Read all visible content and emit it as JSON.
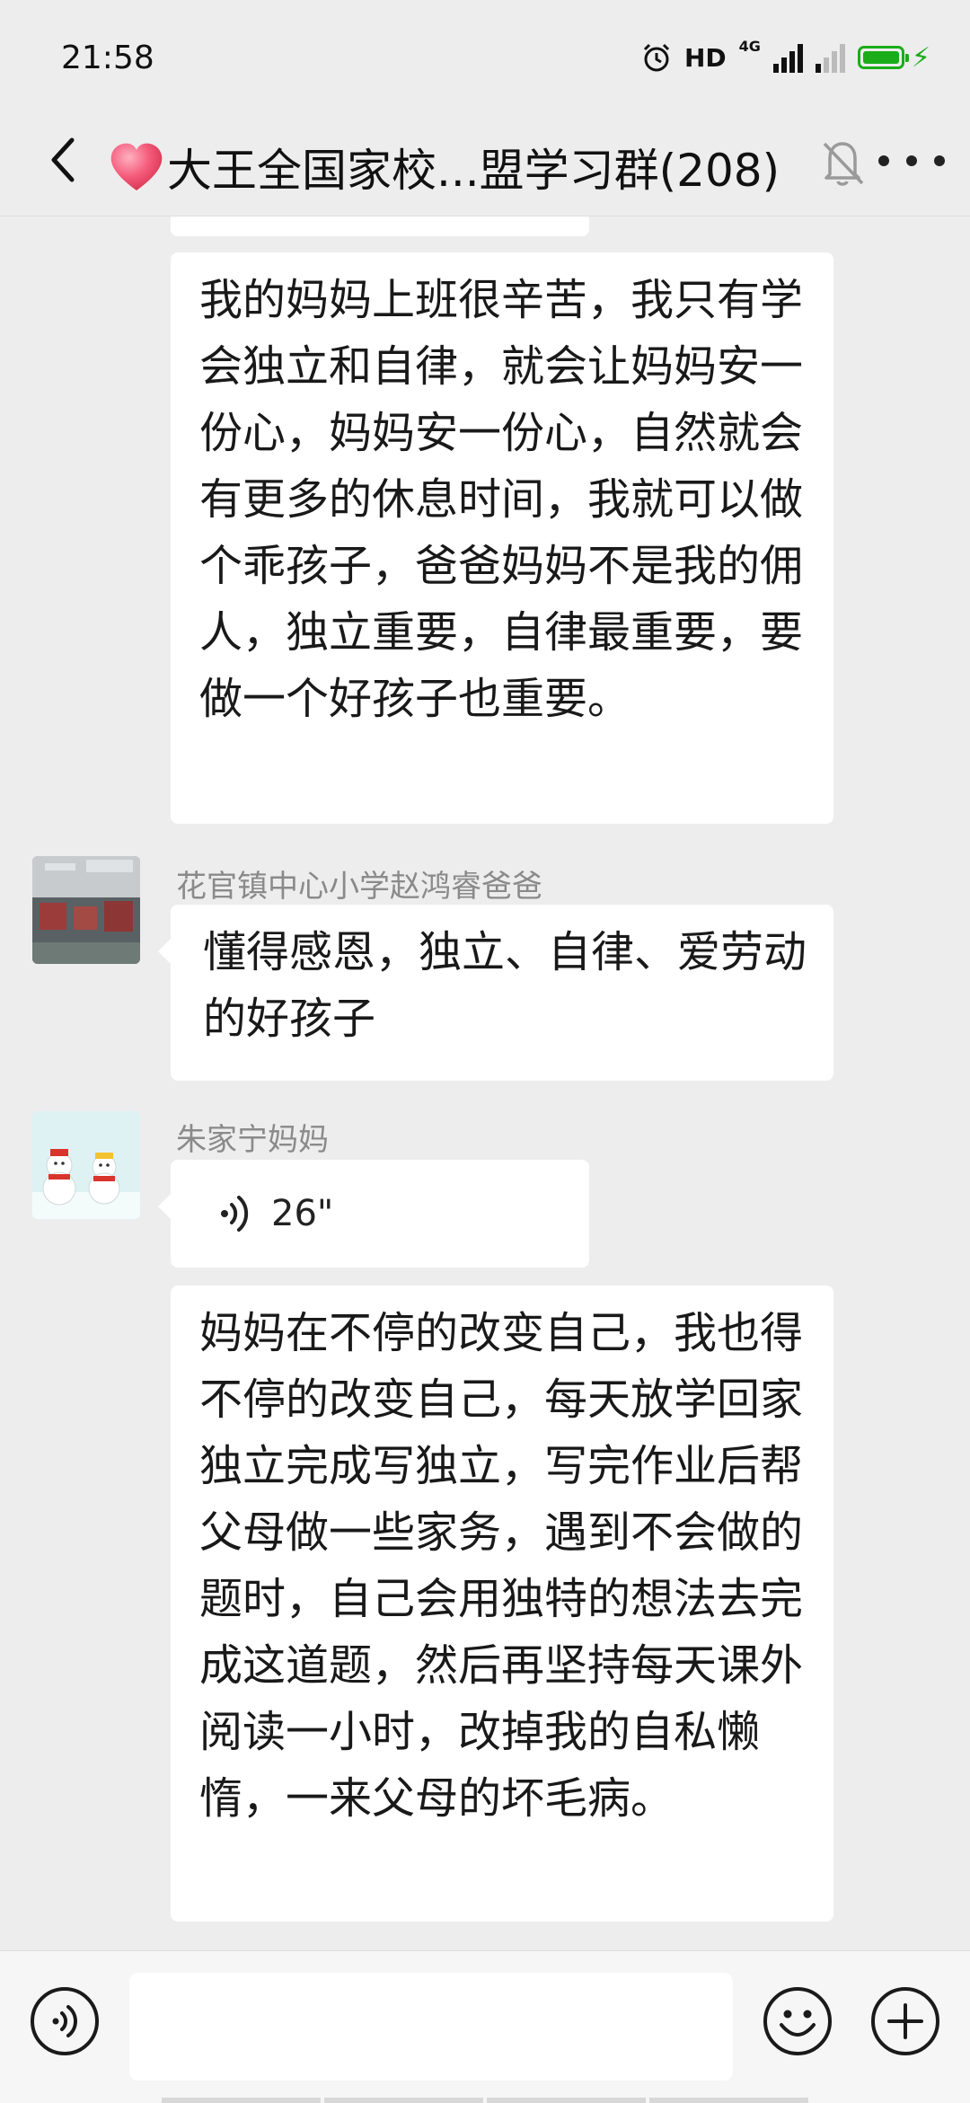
{
  "status_bar": {
    "time": "21:58",
    "hd_label": "HD",
    "network_label": "4G",
    "battery_color": "#1aad19"
  },
  "header": {
    "title": "大王全国家校...盟学习群(208)",
    "icons": [
      "back-arrow-icon",
      "heart-icon",
      "mute-bell-icon",
      "more-icon"
    ]
  },
  "messages": [
    {
      "text": "我的妈妈上班很辛苦，我只有学会独立和自律，就会让妈妈安一份心，妈妈安一份心，自然就会有更多的休息时间，我就可以做个乖孩子，爸爸妈妈不是我的佣人，独立重要，自律最重要，要做一个好孩子也重要。"
    },
    {
      "sender": "花官镇中心小学赵鸿睿爸爸",
      "text": "懂得感恩，独立、自律、爱劳动的好孩子"
    },
    {
      "sender": "朱家宁妈妈",
      "voice_duration": "26\""
    },
    {
      "text": "妈妈在不停的改变自己，我也得不停的改变自己，每天放学回家独立完成写独立，写完作业后帮父母做一些家务，遇到不会做的题时，自己会用独特的想法去完成这道题，然后再坚持每天课外阅读一小时，改掉我的自私懒惰，一来父母的坏毛病。"
    }
  ],
  "input_bar": {
    "icons": [
      "voice-input-icon",
      "emoji-icon",
      "plus-icon"
    ]
  }
}
